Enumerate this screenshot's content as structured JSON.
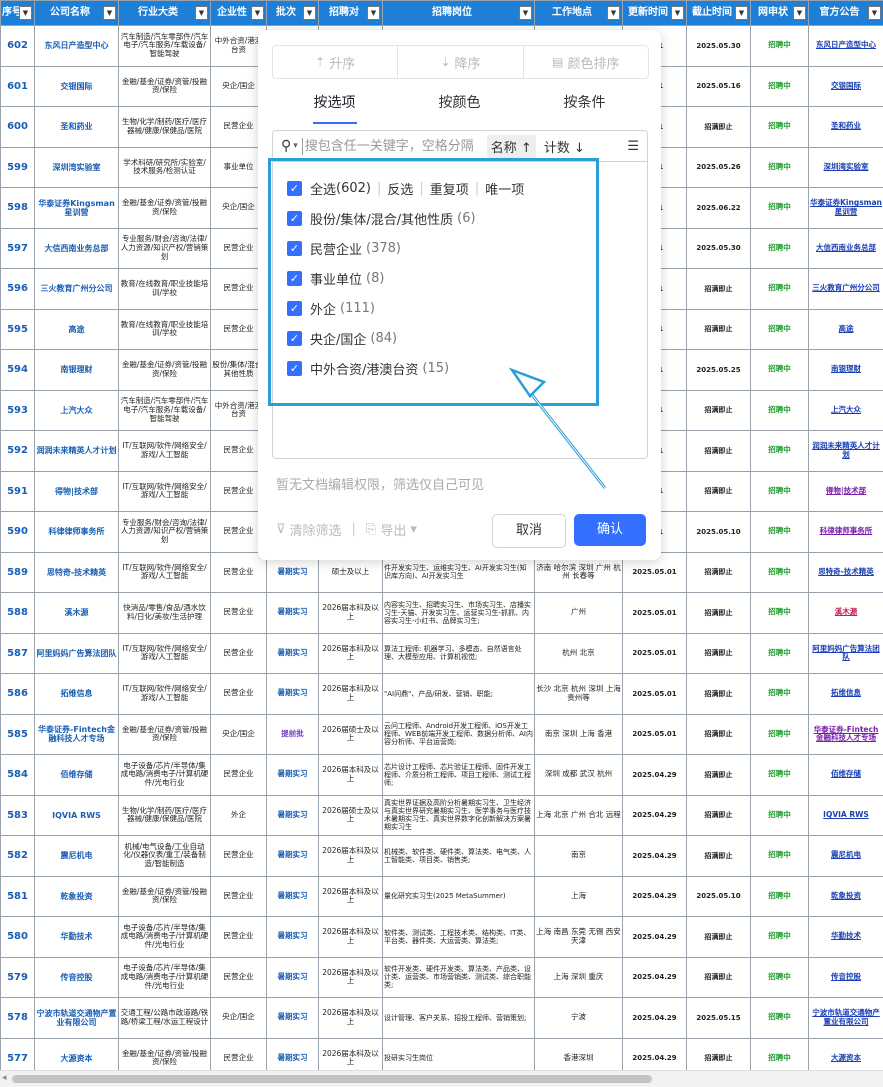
{
  "headers": [
    {
      "label": "序号",
      "id": "seq"
    },
    {
      "label": "公司名称",
      "id": "company"
    },
    {
      "label": "行业大类",
      "id": "industry"
    },
    {
      "label": "企业性",
      "id": "nature"
    },
    {
      "label": "批次",
      "id": "batch"
    },
    {
      "label": "招聘对",
      "id": "target"
    },
    {
      "label": "招聘岗位",
      "id": "positions"
    },
    {
      "label": "工作地点",
      "id": "location"
    },
    {
      "label": "更新时间",
      "id": "updated"
    },
    {
      "label": "截止时间",
      "id": "deadline"
    },
    {
      "label": "网申状",
      "id": "status"
    },
    {
      "label": "官方公告",
      "id": "notice"
    }
  ],
  "rows": [
    {
      "seq": "602",
      "company": "东风日产造型中心",
      "industry": "汽车制造/汽车零部件/汽车电子/汽车服务/车载设备/智能驾驶",
      "nature": "中外合资/港澳台资",
      "batch": "",
      "target": "",
      "positions": "",
      "location": "",
      "updated": "5.01",
      "deadline": "2025.05.30",
      "status": "招聘中",
      "notice": "东风日产造型中心",
      "notice_style": ""
    },
    {
      "seq": "601",
      "company": "交银国际",
      "industry": "金融/基金/证券/资管/投融资/保险",
      "nature": "央企/国企",
      "batch": "",
      "target": "",
      "positions": "",
      "location": "",
      "updated": "5.01",
      "deadline": "2025.05.16",
      "status": "招聘中",
      "notice": "交银国际",
      "notice_style": ""
    },
    {
      "seq": "600",
      "company": "圣和药业",
      "industry": "生物/化学/制药/医疗/医疗器械/健康/保健品/医院",
      "nature": "民营企业",
      "batch": "",
      "target": "",
      "positions": "",
      "location": "",
      "updated": "5.01",
      "deadline": "招满即止",
      "status": "招聘中",
      "notice": "圣和药业",
      "notice_style": ""
    },
    {
      "seq": "599",
      "company": "深圳湾实验室",
      "industry": "学术科研/研究所/实验室/技术服务/检测认证",
      "nature": "事业单位",
      "batch": "",
      "target": "",
      "positions": "",
      "location": "",
      "updated": "5.01",
      "deadline": "2025.05.26",
      "status": "招聘中",
      "notice": "深圳湾实验室",
      "notice_style": ""
    },
    {
      "seq": "598",
      "company": "华泰证券Kingsman星训营",
      "industry": "金融/基金/证券/资管/投融资/保险",
      "nature": "央企/国企",
      "batch": "",
      "target": "",
      "positions": "",
      "location": "",
      "updated": "5.01",
      "deadline": "2025.06.22",
      "status": "招聘中",
      "notice": "华泰证券Kingsman星训营",
      "notice_style": ""
    },
    {
      "seq": "597",
      "company": "大信西南业务总部",
      "industry": "专业服务/财会/咨询/法律/人力资源/知识产权/营销策划",
      "nature": "民营企业",
      "batch": "",
      "target": "",
      "positions": "",
      "location": "",
      "updated": "5.01",
      "deadline": "2025.05.30",
      "status": "招聘中",
      "notice": "大信西南业务总部",
      "notice_style": ""
    },
    {
      "seq": "596",
      "company": "三火教育广州分公司",
      "industry": "教育/在线教育/职业技能培训/学校",
      "nature": "民营企业",
      "batch": "",
      "target": "",
      "positions": "",
      "location": "",
      "updated": "5.01",
      "deadline": "招满即止",
      "status": "招聘中",
      "notice": "三火教育广州分公司",
      "notice_style": ""
    },
    {
      "seq": "595",
      "company": "高途",
      "industry": "教育/在线教育/职业技能培训/学校",
      "nature": "民营企业",
      "batch": "",
      "target": "",
      "positions": "",
      "location": "",
      "updated": "5.01",
      "deadline": "招满即止",
      "status": "招聘中",
      "notice": "高途",
      "notice_style": ""
    },
    {
      "seq": "594",
      "company": "南银理财",
      "industry": "金融/基金/证券/资管/投融资/保险",
      "nature": "股份/集体/混合/其他性质",
      "batch": "",
      "target": "",
      "positions": "",
      "location": "",
      "updated": "5.01",
      "deadline": "2025.05.25",
      "status": "招聘中",
      "notice": "南银理财",
      "notice_style": ""
    },
    {
      "seq": "593",
      "company": "上汽大众",
      "industry": "汽车制造/汽车零部件/汽车电子/汽车服务/车载设备/智能驾驶",
      "nature": "中外合资/港澳台资",
      "batch": "",
      "target": "",
      "positions": "",
      "location": "",
      "updated": "5.01",
      "deadline": "招满即止",
      "status": "招聘中",
      "notice": "上汽大众",
      "notice_style": ""
    },
    {
      "seq": "592",
      "company": "润润未来精英人才计划",
      "industry": "IT/互联网/软件/网络安全/游戏/人工智能",
      "nature": "民营企业",
      "batch": "",
      "target": "",
      "positions": "",
      "location": "",
      "updated": "5.01",
      "deadline": "招满即止",
      "status": "招聘中",
      "notice": "润润未来精英人才计划",
      "notice_style": ""
    },
    {
      "seq": "591",
      "company": "得物|技术部",
      "industry": "IT/互联网/软件/网络安全/游戏/人工智能",
      "nature": "民营企业",
      "batch": "",
      "target": "",
      "positions": "",
      "location": "",
      "updated": "5.01",
      "deadline": "招满即止",
      "status": "招聘中",
      "notice": "得物|技术部",
      "notice_style": "purple"
    },
    {
      "seq": "590",
      "company": "科律律师事务所",
      "industry": "专业服务/财会/咨询/法律/人力资源/知识产权/营销策划",
      "nature": "民营企业",
      "batch": "",
      "target": "",
      "positions": "",
      "location": "",
      "updated": "5.01",
      "deadline": "2025.05.10",
      "status": "招聘中",
      "notice": "科律律师事务所",
      "notice_style": "purple"
    },
    {
      "seq": "589",
      "company": "思特奇-技术精英",
      "industry": "IT/互联网/软件/网络安全/游戏/人工智能",
      "nature": "民营企业",
      "batch": "暑期实习",
      "target": "硕士及以上",
      "positions": "件开发实习生、运维实习生、AI开发实习生(知识库方向)、AI开发实习生",
      "location": "济南 哈尔滨 深圳 广州 杭州 长春等",
      "updated": "2025.05.01",
      "deadline": "招满即止",
      "status": "招聘中",
      "notice": "思特奇-技术精英",
      "notice_style": ""
    },
    {
      "seq": "588",
      "company": "溪木源",
      "industry": "快消品/零售/食品/酒水饮料/日化/美妆/生活护理",
      "nature": "民营企业",
      "batch": "暑期实习",
      "target": "2026届本科及以上",
      "positions": "内容实习生、招聘实习生、市场实习生、店播实习生-天猫、开发实习生、运营实习生-抓抓、内容实习生-小红书、品牌实习生;",
      "location": "广州",
      "updated": "2025.05.01",
      "deadline": "招满即止",
      "status": "招聘中",
      "notice": "溪木源",
      "notice_style": "red"
    },
    {
      "seq": "587",
      "company": "阿里妈妈广告算法团队",
      "industry": "IT/互联网/软件/网络安全/游戏/人工智能",
      "nature": "民营企业",
      "batch": "暑期实习",
      "target": "2026届本科及以上",
      "positions": "算法工程师: 机器学习、多模态、自然语言处理、大模型应用、计算机视觉;",
      "location": "杭州 北京",
      "updated": "2025.05.01",
      "deadline": "招满即止",
      "status": "招聘中",
      "notice": "阿里妈妈广告算法团队",
      "notice_style": ""
    },
    {
      "seq": "586",
      "company": "拓维信息",
      "industry": "IT/互联网/软件/网络安全/游戏/人工智能",
      "nature": "民营企业",
      "batch": "暑期实习",
      "target": "2026届本科及以上",
      "positions": "\"AI问鼎\"、产品/研发、营销、职能;",
      "location": "长沙 北京 杭州 深圳 上海 贵州等",
      "updated": "2025.05.01",
      "deadline": "招满即止",
      "status": "招聘中",
      "notice": "拓维信息",
      "notice_style": ""
    },
    {
      "seq": "585",
      "company": "华泰证券-Fintech金融科技人才专场",
      "industry": "金融/基金/证券/资管/投融资/保险",
      "nature": "央企/国企",
      "batch": "提前批",
      "target": "2026届硕士及以上",
      "positions": "云问工程师、Android开发工程师、iOS开发工程师、WEB前端开发工程师、数据分析师、AI内容分析师、平台运营岗;",
      "location": "南京 深圳 上海 香港",
      "updated": "2025.05.01",
      "deadline": "招满即止",
      "status": "招聘中",
      "notice": "华泰证券-Fintech金融科技人才专场",
      "notice_style": "purple"
    },
    {
      "seq": "584",
      "company": "佰维存储",
      "industry": "电子设备/芯片/半导体/集成电路/消费电子/计算机硬件/光电行业",
      "nature": "民营企业",
      "batch": "暑期实习",
      "target": "2026届本科及以上",
      "positions": "芯片设计工程师、芯片验证工程师、固件开发工程师、介质分析工程师、项目工程师、测试工程师;",
      "location": "深圳 成都 武汉 杭州",
      "updated": "2025.04.29",
      "deadline": "招满即止",
      "status": "招聘中",
      "notice": "佰维存储",
      "notice_style": ""
    },
    {
      "seq": "583",
      "company": "IQVIA RWS",
      "industry": "生物/化学/制药/医疗/医疗器械/健康/保健品/医院",
      "nature": "外企",
      "batch": "暑期实习",
      "target": "2026届硕士及以上",
      "positions": "真实世界证据及高阶分析暑期实习生、卫生经济与真实世界研究暑期实习生、医学事务与医疗技术暑期实习生、真实世界数字化创新解决方案暑期实习生",
      "location": "上海 北京 广州 合北 远程",
      "updated": "2025.04.29",
      "deadline": "招满即止",
      "status": "招聘中",
      "notice": "IQVIA RWS",
      "notice_style": ""
    },
    {
      "seq": "582",
      "company": "震尼机电",
      "industry": "机械/电气设备/工业自动化/仪器仪表/重工/装备制造/智能制造",
      "nature": "民营企业",
      "batch": "暑期实习",
      "target": "2026届本科及以上",
      "positions": "机械类、软件类、硬件类、算法类、电气类、人工智能类、项目类、销售类;",
      "location": "南京",
      "updated": "2025.04.29",
      "deadline": "招满即止",
      "status": "招聘中",
      "notice": "震尼机电",
      "notice_style": ""
    },
    {
      "seq": "581",
      "company": "乾象投资",
      "industry": "金融/基金/证券/资管/投融资/保险",
      "nature": "民营企业",
      "batch": "暑期实习",
      "target": "2026届本科及以上",
      "positions": "量化研究实习生(2025 MetaSummer)",
      "location": "上海",
      "updated": "2025.04.29",
      "deadline": "2025.05.10",
      "status": "招聘中",
      "notice": "乾象投资",
      "notice_style": ""
    },
    {
      "seq": "580",
      "company": "华勤技术",
      "industry": "电子设备/芯片/半导体/集成电路/消费电子/计算机硬件/光电行业",
      "nature": "民营企业",
      "batch": "暑期实习",
      "target": "2026届本科及以上",
      "positions": "软件类、测试类、工程技术类、结构类、IT类、平台类、器件类、大运营类、算法类;",
      "location": "上海 南昌 东莞 无锡 西安 天津",
      "updated": "2025.04.29",
      "deadline": "招满即止",
      "status": "招聘中",
      "notice": "华勤技术",
      "notice_style": ""
    },
    {
      "seq": "579",
      "company": "传音控股",
      "industry": "电子设备/芯片/半导体/集成电路/消费电子/计算机硬件/光电行业",
      "nature": "民营企业",
      "batch": "暑期实习",
      "target": "2026届本科及以上",
      "positions": "软件开发类、硬件开发类、算法类、产品类、设计类、运营类、市场营销类、测试类、综合职能类;",
      "location": "上海 深圳 重庆",
      "updated": "2025.04.29",
      "deadline": "招满即止",
      "status": "招聘中",
      "notice": "传音控股",
      "notice_style": ""
    },
    {
      "seq": "578",
      "company": "宁波市轨道交通物产置业有限公司",
      "industry": "交通工程/公路市政道路/铁路/桥梁工程/水运工程设计",
      "nature": "央企/国企",
      "batch": "暑期实习",
      "target": "2026届本科及以上",
      "positions": "设计管理、客户关系、招投工程师、营销策划;",
      "location": "宁波",
      "updated": "2025.04.29",
      "deadline": "2025.05.15",
      "status": "招聘中",
      "notice": "宁波市轨道交通物产置业有限公司",
      "notice_style": ""
    },
    {
      "seq": "577",
      "company": "大源资本",
      "industry": "金融/基金/证券/资管/投融资/保险",
      "nature": "民营企业",
      "batch": "暑期实习",
      "target": "2026届本科及以上",
      "positions": "投研实习生岗位",
      "location": "香港深圳",
      "updated": "2025.04.29",
      "deadline": "招满即止",
      "status": "招聘中",
      "notice": "大源资本",
      "notice_style": ""
    }
  ],
  "filter_popup": {
    "sort_buttons": [
      {
        "icon": "⇡",
        "label": "升序"
      },
      {
        "icon": "⇣",
        "label": "降序"
      },
      {
        "icon": "▤",
        "label": "颜色排序"
      }
    ],
    "tabs": [
      "按选项",
      "按颜色",
      "按条件"
    ],
    "active_tab": 0,
    "search_placeholder": "搜包含任一关键字，空格分隔",
    "sort_name": "名称 ↑",
    "sort_count": "计数 ↓",
    "select_all": {
      "label": "全选",
      "count": "(602)"
    },
    "quick_actions": [
      "反选",
      "重复项",
      "唯一项"
    ],
    "options": [
      {
        "label": "股份/集体/混合/其他性质",
        "count": "(6)",
        "checked": true
      },
      {
        "label": "民营企业",
        "count": "(378)",
        "checked": true
      },
      {
        "label": "事业单位",
        "count": "(8)",
        "checked": true
      },
      {
        "label": "外企",
        "count": "(111)",
        "checked": true
      },
      {
        "label": "央企/国企",
        "count": "(84)",
        "checked": true
      },
      {
        "label": "中外合资/港澳台资",
        "count": "(15)",
        "checked": true
      }
    ],
    "note": "暂无文档编辑权限，筛选仅自己可见",
    "clear_label": "清除筛选",
    "export_label": "导出",
    "cancel_label": "取消",
    "confirm_label": "确认"
  },
  "colors": {
    "header_bg": "#1e7fd6",
    "accent": "#3370ff",
    "status_green": "#1e9b2c",
    "annotation": "#2a9fd6"
  }
}
